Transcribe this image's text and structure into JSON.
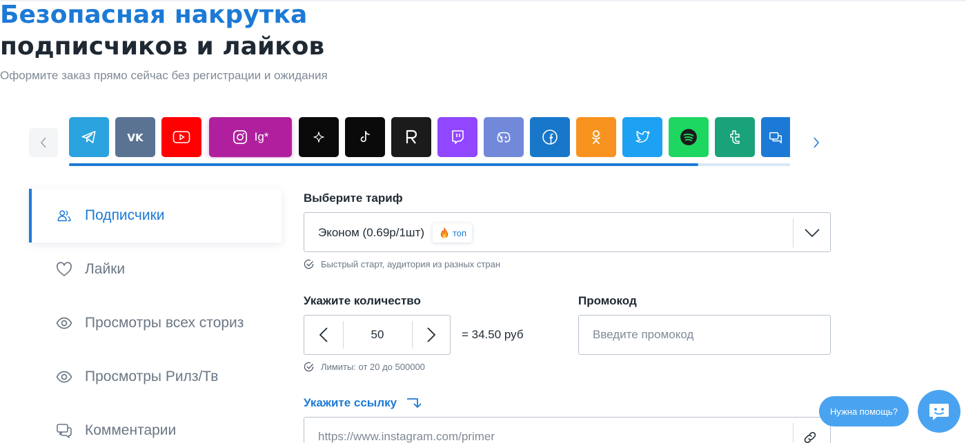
{
  "hero": {
    "title_line1": "Безопасная накрутка",
    "title_line2": "подписчиков и лайков",
    "subtitle": "Оформите заказ прямо сейчас без регистрации и ожидания"
  },
  "networks": {
    "selected": "instagram",
    "items": [
      {
        "id": "telegram",
        "icon": "telegram-icon",
        "color": "#2aa3df"
      },
      {
        "id": "vk",
        "icon": "vk-icon",
        "color": "#5a7393"
      },
      {
        "id": "youtube",
        "icon": "youtube-icon",
        "color": "#ff0000"
      },
      {
        "id": "instagram",
        "icon": "instagram-icon",
        "label": "Ig*",
        "color": "#b0209e"
      },
      {
        "id": "sparkle",
        "icon": "sparkle-icon",
        "color": "#0a0a0a"
      },
      {
        "id": "tiktok",
        "icon": "tiktok-icon",
        "color": "#0a0a0a"
      },
      {
        "id": "rutube",
        "icon": "rutube-r-icon",
        "color": "#1b1b1b"
      },
      {
        "id": "twitch",
        "icon": "twitch-icon",
        "color": "#9146ff"
      },
      {
        "id": "discord",
        "icon": "discord-icon",
        "color": "#7289da"
      },
      {
        "id": "facebook",
        "icon": "facebook-icon",
        "color": "#1877c9"
      },
      {
        "id": "odnoklassniki",
        "icon": "odnoklassniki-icon",
        "color": "#f7931e"
      },
      {
        "id": "twitter",
        "icon": "twitter-icon",
        "color": "#1da1f2"
      },
      {
        "id": "spotify",
        "icon": "spotify-icon",
        "color": "#1ed760"
      },
      {
        "id": "tumblr",
        "icon": "tumblr-icon",
        "color": "#1aa37a"
      },
      {
        "id": "chat",
        "icon": "chat-icon",
        "color": "#1c7ad6"
      }
    ],
    "scroll_progress": 0.873
  },
  "sidebar": {
    "items": [
      {
        "label": "Подписчики",
        "icon": "users-icon",
        "active": true
      },
      {
        "label": "Лайки",
        "icon": "heart-icon",
        "active": false
      },
      {
        "label": "Просмотры всех сториз",
        "icon": "eye-icon",
        "active": false
      },
      {
        "label": "Просмотры Рилз/Тв",
        "icon": "eye-icon",
        "active": false
      },
      {
        "label": "Комментарии",
        "icon": "comments-icon",
        "active": false
      }
    ]
  },
  "tariff": {
    "label": "Выберите тариф",
    "selected": "Эконом (0.69р/1шт)",
    "badge": "топ",
    "hint": "Быстрый старт, аудитория из разных стран"
  },
  "quantity": {
    "label": "Укажите количество",
    "value": "50",
    "price": "= 34.50 руб",
    "hint": "Лимиты: от 20 до 500000"
  },
  "promo": {
    "label": "Промокод",
    "placeholder": "Введите промокод"
  },
  "link": {
    "label": "Укажите ссылку",
    "placeholder": "https://www.instagram.com/primer"
  },
  "help": {
    "bubble": "Нужна помощь?"
  }
}
